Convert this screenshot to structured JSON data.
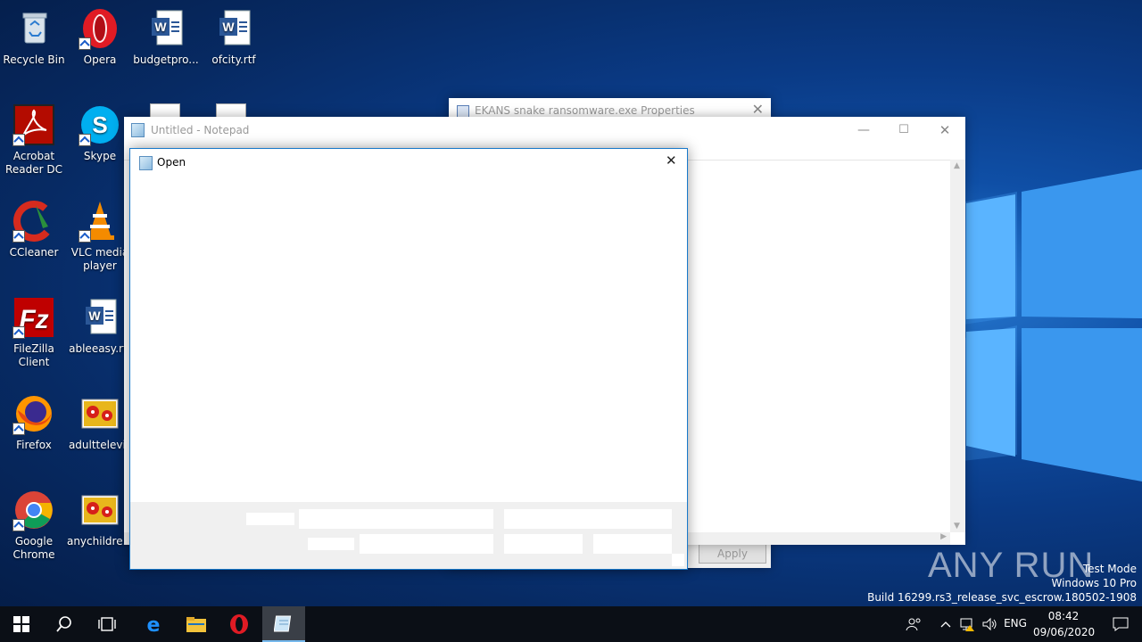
{
  "desktop": {
    "icons": [
      {
        "label": "Recycle Bin"
      },
      {
        "label": "Opera"
      },
      {
        "label": "budgetpro..."
      },
      {
        "label": "ofcity.rtf"
      },
      {
        "label": "Acrobat Reader DC"
      },
      {
        "label": "Skype"
      },
      {
        "label": "CCleaner"
      },
      {
        "label": "VLC media player"
      },
      {
        "label": "FileZilla Client"
      },
      {
        "label": "ableeasy.rtf"
      },
      {
        "label": "Firefox"
      },
      {
        "label": "adulttelevis"
      },
      {
        "label": "Google Chrome"
      },
      {
        "label": "anychildre..."
      }
    ]
  },
  "properties_window": {
    "title": "EKANS snake ransomware.exe Properties",
    "apply_label": "Apply"
  },
  "notepad": {
    "title": "Untitled - Notepad"
  },
  "open_dialog": {
    "title": "Open"
  },
  "watermark": {
    "brand": "ANY RUN",
    "line1": "Test Mode",
    "line2": "Windows 10 Pro",
    "line3": "Build 16299.rs3_release_svc_escrow.180502-1908"
  },
  "taskbar": {
    "language": "ENG",
    "time": "08:42",
    "date": "09/06/2020"
  },
  "colors": {
    "accent": "#1979ca",
    "taskbar": "#0b0f16"
  }
}
